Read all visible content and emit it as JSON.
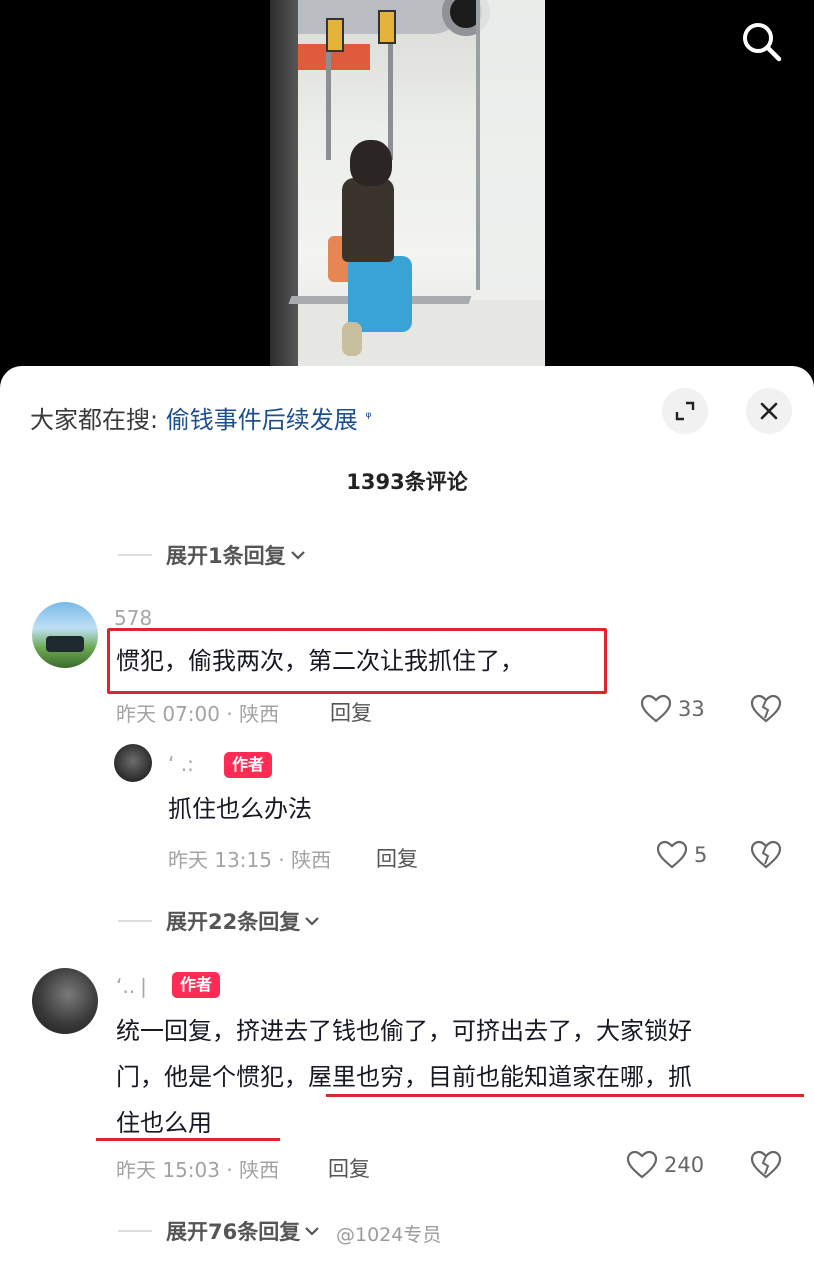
{
  "video": {
    "search_icon": "search-icon"
  },
  "header": {
    "hot_prefix": "大家都在搜:",
    "hot_keyword": "偷钱事件后续发展",
    "hot_icon": "ᵠ",
    "expand_icon": "expand-icon",
    "close_icon": "close-icon"
  },
  "comments_count": "1393条评论",
  "expand_top": "展开1条回复",
  "comment1": {
    "user": "578",
    "text": "惯犯，偷我两次，第二次让我抓住了，",
    "meta": "昨天 07:00 · 陕西",
    "reply": "回复",
    "likes": "33"
  },
  "reply1": {
    "user": "‘ .:",
    "badge": "作者",
    "text": "抓住也么办法",
    "meta": "昨天 13:15 · 陕西",
    "reply": "回复",
    "likes": "5"
  },
  "expand_mid": "展开22条回复",
  "comment2": {
    "user": "‘..❘",
    "badge": "作者",
    "line1": "统一回复，挤进去了钱也偷了，可挤出去了，大家锁好",
    "line2": "门，他是个惯犯，屋里也穷，目前也能知道家在哪，抓",
    "line3": "住也么用",
    "meta": "昨天 15:03 · 陕西",
    "reply": "回复",
    "likes": "240"
  },
  "expand_bottom": "展开76条回复",
  "watermark": "@1024专员",
  "colors": {
    "accent_red": "#fe2c55",
    "highlight_red": "#e0252a",
    "link_blue": "#1d4f8f"
  }
}
